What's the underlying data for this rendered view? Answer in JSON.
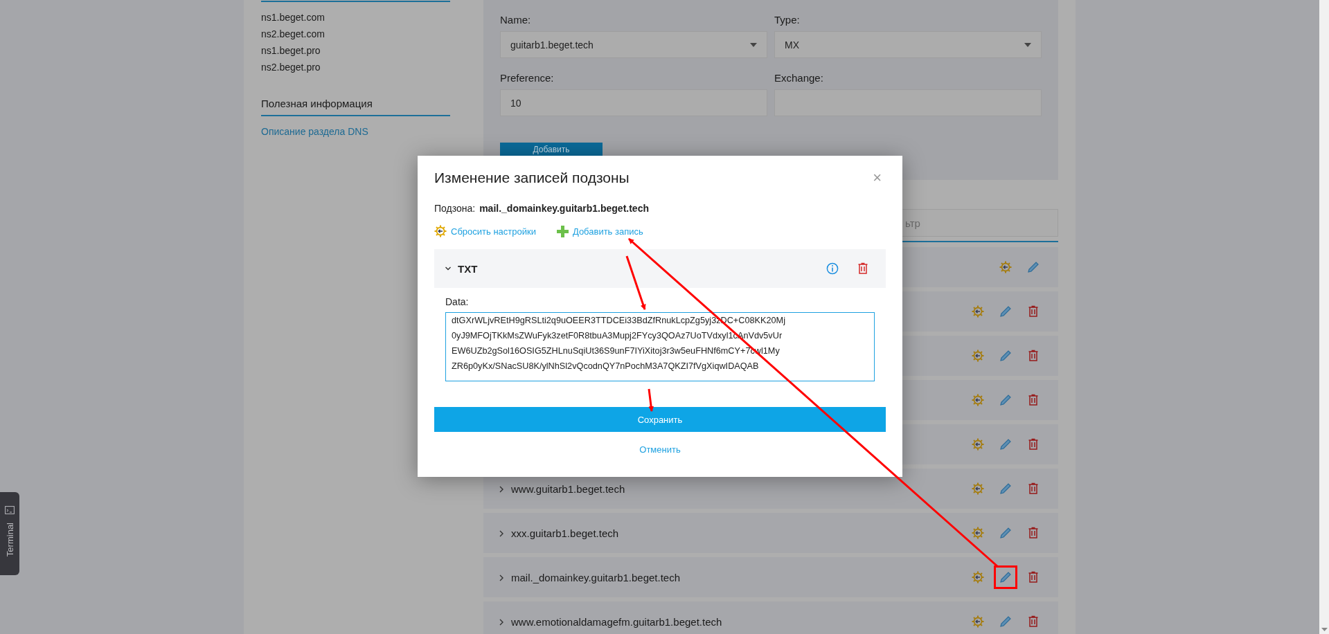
{
  "sidebar": {
    "ns_servers": [
      "ns1.beget.com",
      "ns2.beget.com",
      "ns1.beget.pro",
      "ns2.beget.pro"
    ],
    "info_heading": "Полезная информация",
    "info_links": [
      "Описание раздела DNS"
    ]
  },
  "form": {
    "fields": [
      {
        "kind": "select",
        "label": "Name:",
        "value": "guitarb1.beget.tech"
      },
      {
        "kind": "select",
        "label": "Type:",
        "value": "MX"
      },
      {
        "kind": "input",
        "label": "Preference:",
        "value": "10"
      },
      {
        "kind": "input",
        "label": "Exchange:"
      }
    ],
    "submit": "Добавить"
  },
  "filter": {
    "placeholder": "ьтр"
  },
  "records": [
    {
      "deletable": false,
      "highlighted": false
    },
    {
      "deletable": true,
      "highlighted": false
    },
    {
      "deletable": true,
      "highlighted": false
    },
    {
      "deletable": true,
      "highlighted": false
    },
    {
      "deletable": true,
      "highlighted": false
    },
    {
      "name": "www.guitarb1.beget.tech",
      "expanded": false,
      "deletable": true,
      "highlighted": false
    },
    {
      "name": "xxx.guitarb1.beget.tech",
      "expanded": false,
      "deletable": true,
      "highlighted": false
    },
    {
      "name": "mail._domainkey.guitarb1.beget.tech",
      "expanded": false,
      "deletable": true,
      "highlighted": true
    },
    {
      "name": "www.emotionaldamagefm.guitarb1.beget.tech",
      "expanded": false,
      "deletable": true,
      "highlighted": false
    }
  ],
  "modal": {
    "title": "Изменение записей подзоны",
    "close": "×",
    "subzone_label": "Подзона:",
    "subzone": "mail._domainkey.guitarb1.beget.tech",
    "actions": [
      {
        "kind": "reset",
        "label": "Сбросить настройки"
      },
      {
        "kind": "add",
        "label": "Добавить запись"
      }
    ],
    "record": {
      "type": "TXT",
      "expanded": true,
      "field_label": "Data:",
      "lines": [
        "dtGXrWLjvREtH9gRSLti2q9uOEER3TTDCEi33BdZfRnukLcpZg5yj3zDC+C08KK20Mj",
        "0yJ9MFOjTKkMsZWuFyk3zetF0R8tbuA3Mupj2FYcy3QOAz7UoTVdxyl1cAnVdv5vUr",
        "EW6UZb2gSol16OSIG5ZHLnuSqiUt36S9unF7IYiXitoj3r3w5euFHNf6mCY+7cwl1My",
        "ZR6p0yKx/SNacSU8K/ylNhSl2vQcodnQY7nPochM3A7QKZI7fVgXiqwIDAQAB"
      ]
    },
    "save": "Сохранить",
    "cancel": "Отменить"
  },
  "terminal": {
    "label": "Terminal"
  }
}
